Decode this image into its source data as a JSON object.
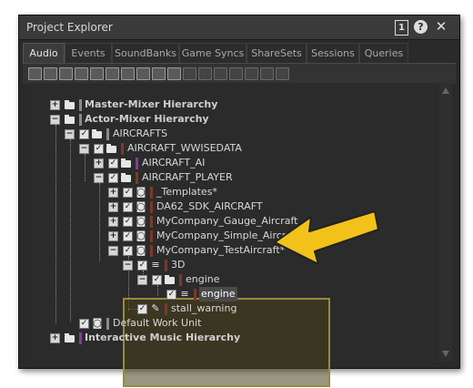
{
  "window": {
    "title": "Project Explorer",
    "btn_one": "1",
    "btn_help": "?",
    "btn_close": "✕"
  },
  "tabs": [
    "Audio",
    "Events",
    "SoundBanks",
    "Game Syncs",
    "ShareSets",
    "Sessions",
    "Queries"
  ],
  "active_tab": "Audio",
  "tree": {
    "master_mixer": "Master-Mixer Hierarchy",
    "actor_mixer": "Actor-Mixer Hierarchy",
    "aircrafts": "AIRCRAFTS",
    "aircraft_wwisedata": "AIRCRAFT_WWISEDATA",
    "aircraft_ai": "AIRCRAFT_AI",
    "aircraft_player": "AIRCRAFT_PLAYER",
    "templates": "_Templates*",
    "da62": "DA62_SDK_AIRCRAFT",
    "gauge": "MyCompany_Gauge_Aircraft",
    "simple": "MyCompany_Simple_Aircraft*",
    "test": "MyCompany_TestAircraft*",
    "three_d": "3D",
    "engine_folder": "engine",
    "engine_item": "engine",
    "stall": "stall_warning",
    "default_wu": "Default Work Unit",
    "interactive_music": "Interactive Music Hierarchy"
  },
  "colors": {
    "highlight_border": "#9a8a3a",
    "arrow_fill": "#f2c21a",
    "arrow_stroke": "#222222",
    "swatch_brown": "#7a3a2a",
    "swatch_purple": "#8a3aa0",
    "swatch_gray": "#8a8a8a"
  },
  "icons": {
    "exp_plus": "+",
    "exp_minus": "−",
    "check": "✓",
    "work_unit": "◙",
    "container": "≡",
    "sfx": "✎"
  }
}
